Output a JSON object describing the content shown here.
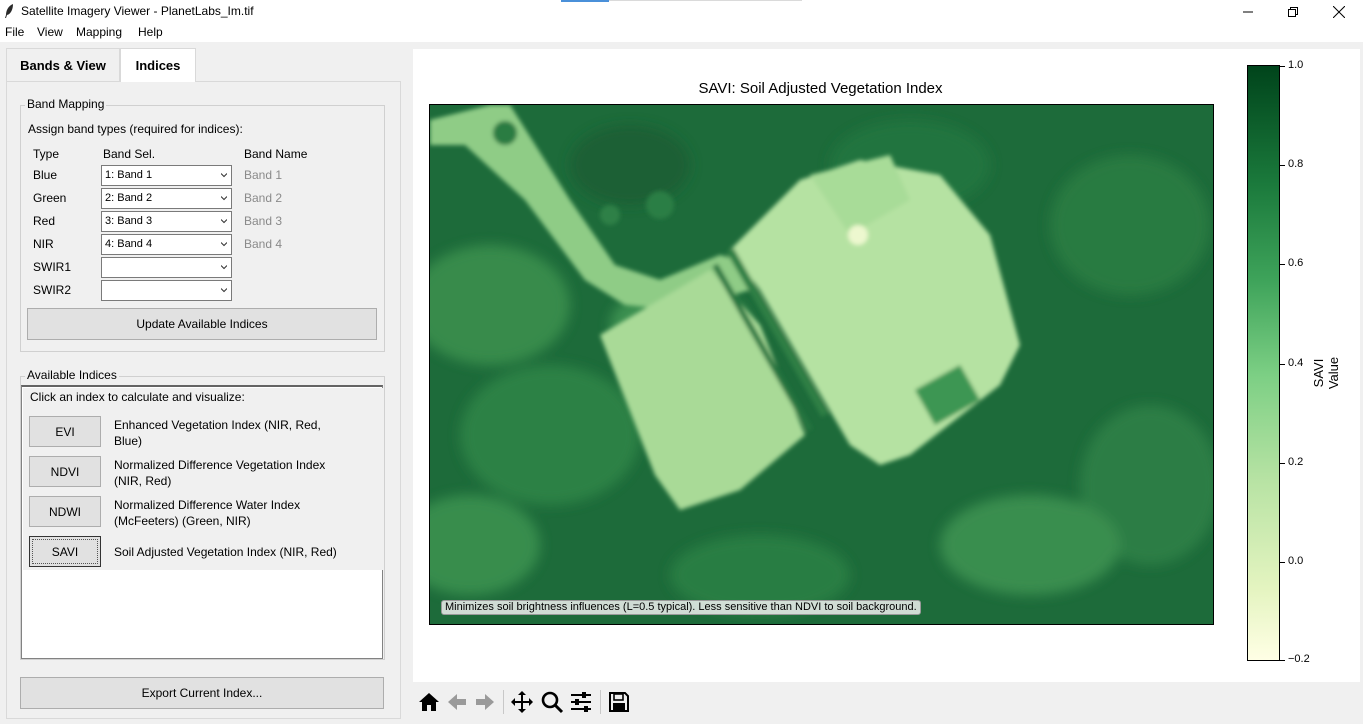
{
  "window": {
    "title": "Satellite Imagery Viewer - PlanetLabs_Im.tif",
    "controls": [
      "minimize",
      "maximize",
      "close"
    ]
  },
  "menu": [
    "File",
    "View",
    "Mapping",
    "Help"
  ],
  "tabs": [
    {
      "label": "Bands & View",
      "active": false
    },
    {
      "label": "Indices",
      "active": true
    }
  ],
  "band_mapping": {
    "frame_title": "Band Mapping",
    "instruction": "Assign band types (required for indices):",
    "headers": [
      "Type",
      "Band Sel.",
      "Band Name"
    ],
    "rows": [
      {
        "type": "Blue",
        "selected": "1: Band 1",
        "band_name": "Band 1"
      },
      {
        "type": "Green",
        "selected": "2: Band 2",
        "band_name": "Band 2"
      },
      {
        "type": "Red",
        "selected": "3: Band 3",
        "band_name": "Band 3"
      },
      {
        "type": "NIR",
        "selected": "4: Band 4",
        "band_name": "Band 4"
      },
      {
        "type": "SWIR1",
        "selected": "",
        "band_name": ""
      },
      {
        "type": "SWIR2",
        "selected": "",
        "band_name": ""
      }
    ],
    "update_button": "Update Available Indices"
  },
  "available_indices": {
    "frame_title": "Available Indices",
    "instruction": "Click an index to calculate and visualize:",
    "items": [
      {
        "button": "EVI",
        "desc_line1": "Enhanced Vegetation Index (NIR, Red,",
        "desc_line2": "Blue)"
      },
      {
        "button": "NDVI",
        "desc_line1": "Normalized Difference Vegetation Index",
        "desc_line2": "(NIR, Red)"
      },
      {
        "button": "NDWI",
        "desc_line1": "Normalized Difference Water Index",
        "desc_line2": "(McFeeters) (Green, NIR)"
      },
      {
        "button": "SAVI",
        "desc_line1": "Soil Adjusted Vegetation Index (NIR, Red)",
        "desc_line2": ""
      }
    ],
    "selected": "SAVI"
  },
  "export_button": "Export Current Index...",
  "plot": {
    "title": "SAVI: Soil Adjusted Vegetation Index",
    "caption": "Minimizes soil brightness influences (L=0.5 typical). Less sensitive than NDVI to soil background.",
    "colorbar": {
      "label": "SAVI Value",
      "min": -0.2,
      "max": 1.0,
      "ticks": [
        "1.0",
        "0.8",
        "0.6",
        "0.4",
        "0.2",
        "0.0",
        "−0.2"
      ],
      "colormap": [
        "#ffffe5",
        "#e4f4c0",
        "#b8e3a4",
        "#7ccf84",
        "#3ea35a",
        "#1b7a3c",
        "#00441b"
      ]
    }
  },
  "toolbar": [
    "home-icon",
    "back-icon",
    "forward-icon",
    "pan-icon",
    "zoom-icon",
    "configure-subplots-icon",
    "save-icon"
  ]
}
